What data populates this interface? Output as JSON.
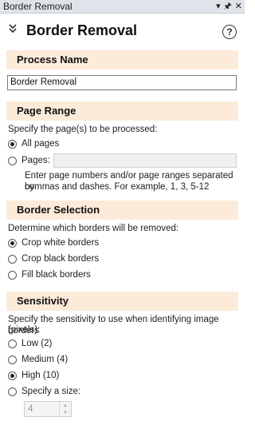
{
  "window": {
    "title": "Border Removal",
    "controls": {
      "dropdown": "▾",
      "pin": "🖈",
      "close": "✕"
    }
  },
  "header": {
    "title": "Border Removal",
    "help": "?"
  },
  "process_name": {
    "heading": "Process Name",
    "value": "Border Removal"
  },
  "page_range": {
    "heading": "Page Range",
    "description": "Specify the page(s) to be processed:",
    "options": [
      {
        "label": "All pages",
        "selected": true
      },
      {
        "label": "Pages:",
        "selected": false
      }
    ],
    "pages_value": "",
    "hint_line1": "Enter page numbers and/or page ranges separated by",
    "hint_line2": "commas and dashes.  For example, 1, 3, 5-12"
  },
  "border_selection": {
    "heading": "Border Selection",
    "description": "Determine which borders will be removed:",
    "options": [
      {
        "label": "Crop white borders",
        "selected": true
      },
      {
        "label": "Crop black borders",
        "selected": false
      },
      {
        "label": "Fill black borders",
        "selected": false
      }
    ]
  },
  "sensitivity": {
    "heading": "Sensitivity",
    "description_line1": "Specify the sensitivity to use when identifying image borders",
    "description_line2": "(pixels):",
    "options": [
      {
        "label": "Low (2)",
        "selected": false
      },
      {
        "label": "Medium (4)",
        "selected": false
      },
      {
        "label": "High (10)",
        "selected": true
      },
      {
        "label": "Specify a size:",
        "selected": false
      }
    ],
    "size_value": "4"
  }
}
